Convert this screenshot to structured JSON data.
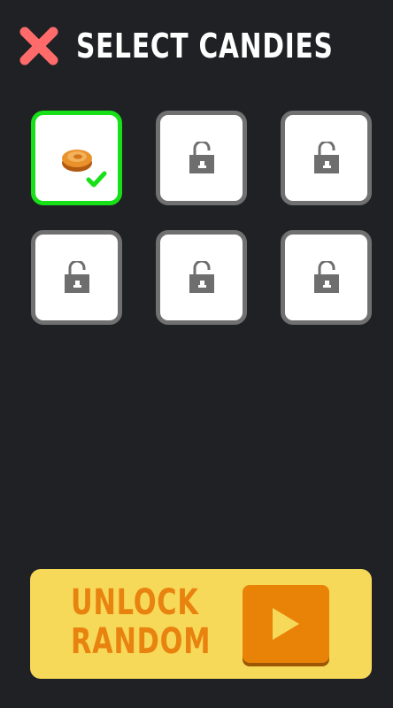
{
  "header": {
    "title": "SELECT CANDIES",
    "close_icon": "close-x-icon",
    "close_color": "#ff6b6b"
  },
  "candy_slots": [
    {
      "state": "selected",
      "icon": "candy-icon"
    },
    {
      "state": "locked",
      "icon": "padlock-icon"
    },
    {
      "state": "locked",
      "icon": "padlock-icon"
    },
    {
      "state": "locked",
      "icon": "padlock-icon"
    },
    {
      "state": "locked",
      "icon": "padlock-icon"
    },
    {
      "state": "locked",
      "icon": "padlock-icon"
    }
  ],
  "unlock_button": {
    "label": "UNLOCK\nRANDOM",
    "icon": "play-icon",
    "background": "#f7d95a",
    "accent": "#e98308"
  },
  "colors": {
    "background": "#1f2125",
    "selected_border": "#18e018",
    "locked_border": "#707070"
  }
}
